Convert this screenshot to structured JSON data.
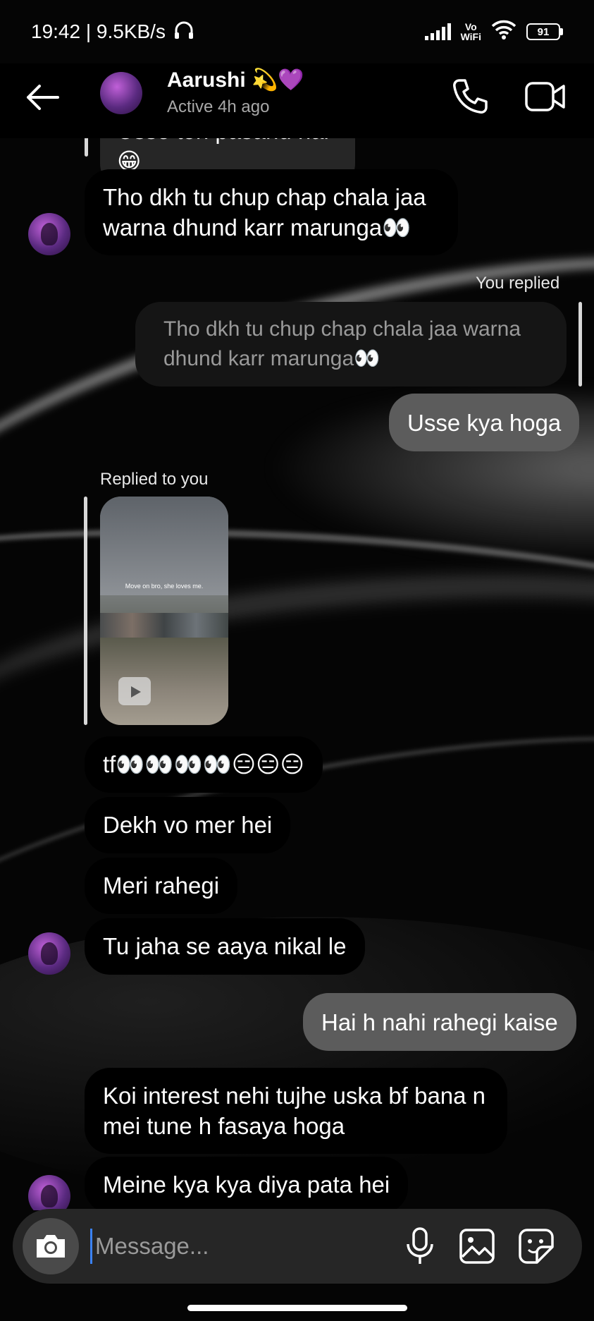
{
  "status_bar": {
    "time_speed": "19:42 | 9.5KB/s",
    "vowifi_line1": "Vo",
    "vowifi_line2": "WiFi",
    "battery": "91"
  },
  "header": {
    "name": "Aarushi 💫💜",
    "status": "Active 4h ago"
  },
  "messages": {
    "m0": "Usse toh pasand hai 😁",
    "m1": "Tho dkh tu chup chap chala jaa warna dhund karr marunga👀",
    "reply_label_1": "You replied",
    "quote_1": "Tho dkh tu chup chap chala jaa warna dhund karr marunga👀",
    "m2": "Usse kya hoga",
    "reply_label_2": "Replied to you",
    "reel_caption": "Move on bro, she loves me.",
    "m3": "tf👀👀👀👀😑😑😑",
    "m4": "Dekh vo mer hei",
    "m5": "Meri rahegi",
    "m6": "Tu jaha se aaya nikal le",
    "m7": "Hai h nahi rahegi kaise",
    "m8": "Koi interest nehi tujhe uska bf bana n mei tune h fasaya hoga",
    "m9": "Meine kya kya diya pata hei"
  },
  "composer": {
    "placeholder": "Message..."
  }
}
